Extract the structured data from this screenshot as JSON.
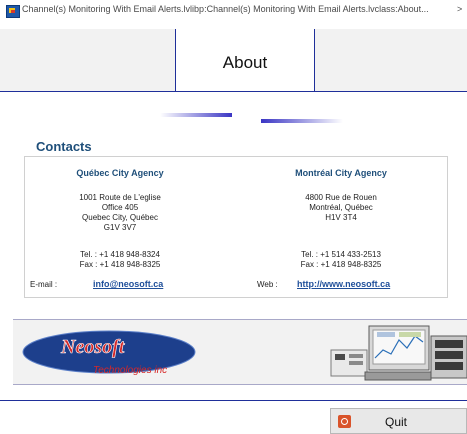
{
  "window": {
    "title": "Channel(s) Monitoring With Email Alerts.lvlibp:Channel(s) Monitoring With Email Alerts.lvclass:About...",
    "chevron": ">",
    "app_icon": "labview-app-icon"
  },
  "header": {
    "title": "About"
  },
  "contacts": {
    "title": "Contacts",
    "quebec": {
      "name": "Québec City Agency",
      "address": [
        "1001 Route de L'eglise",
        "Office 405",
        "Quebec City, Québec",
        "G1V 3V7"
      ],
      "tel": "Tel. : +1 418 948-8324",
      "fax": "Fax : +1 418 948-8325",
      "email_label": "E-mail :",
      "email": "info@neosoft.ca"
    },
    "montreal": {
      "name": "Montréal City Agency",
      "address": [
        "4800 Rue de Rouen",
        "Montréal, Québec",
        "H1V 3T4"
      ],
      "tel": "Tel. : +1 514 433-2513",
      "fax": "Fax : +1 418 948-8325",
      "web_label": "Web :",
      "web": "http://www.neosoft.ca"
    }
  },
  "banner": {
    "logo_name": "Neosoft",
    "logo_tagline": "Technologies inc"
  },
  "footer": {
    "quit_label": "Quit",
    "quit_icon": "power-icon"
  },
  "colors": {
    "accent_line": "#1f2f9a",
    "heading": "#1f4f7a",
    "link": "#1f4f9a",
    "logo_red": "#d62828",
    "logo_ellipse": "#1d3f8c"
  }
}
